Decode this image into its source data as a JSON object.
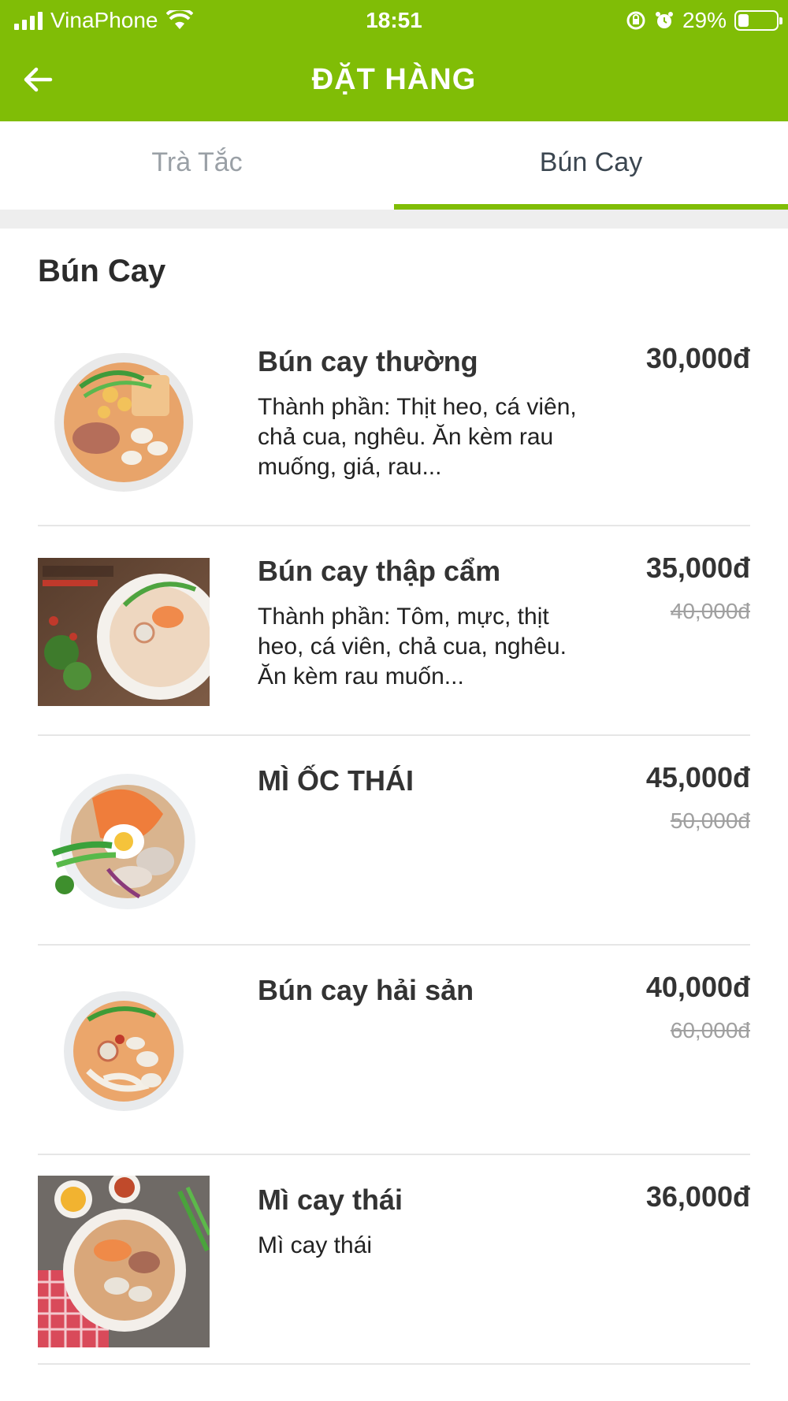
{
  "status_bar": {
    "carrier": "VinaPhone",
    "time": "18:51",
    "battery": "29%",
    "battery_level": 0.29
  },
  "header": {
    "title": "ĐẶT HÀNG"
  },
  "tabs": [
    {
      "label": "Trà Tắc",
      "active": false
    },
    {
      "label": "Bún Cay",
      "active": true
    }
  ],
  "section": {
    "title": "Bún Cay"
  },
  "items": [
    {
      "name": "Bún cay thường",
      "desc": "Thành phần: Thịt heo, cá viên, chả cua, nghêu. Ăn kèm rau muống, giá, rau...",
      "price": "30,000đ",
      "old_price": ""
    },
    {
      "name": "Bún cay thập cẩm",
      "desc": "Thành phần: Tôm, mực, thịt heo, cá viên, chả cua, nghêu. Ăn kèm rau muốn...",
      "price": "35,000đ",
      "old_price": "40,000đ"
    },
    {
      "name": "MÌ ỐC THÁI",
      "desc": "",
      "price": "45,000đ",
      "old_price": "50,000đ"
    },
    {
      "name": "Bún cay hải sản",
      "desc": "",
      "price": "40,000đ",
      "old_price": "60,000đ"
    },
    {
      "name": "Mì cay thái",
      "desc": "Mì cay thái",
      "price": "36,000đ",
      "old_price": ""
    }
  ],
  "colors": {
    "brand": "#80bd06",
    "text": "#2b2b2b",
    "muted": "#9aa0a6"
  }
}
